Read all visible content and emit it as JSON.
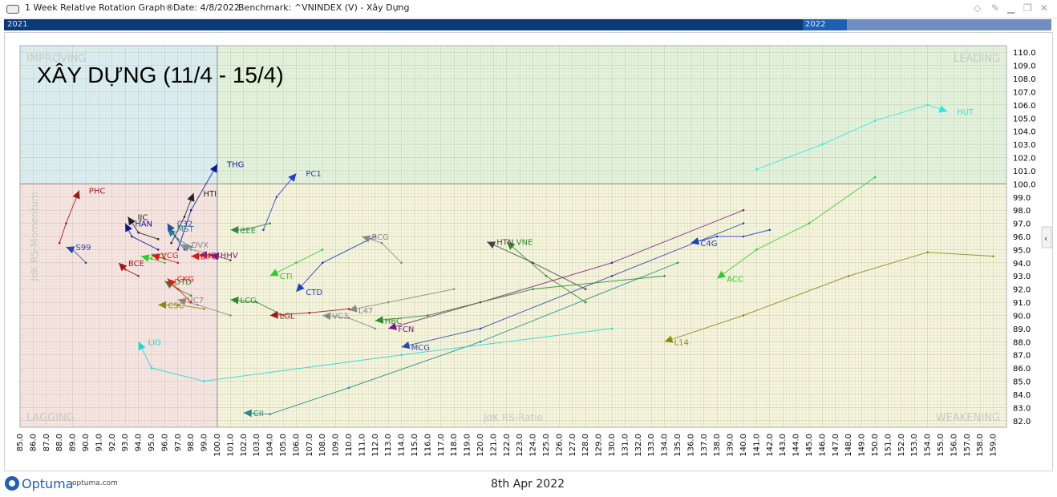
{
  "window": {
    "title": "1 Week Relative Rotation Graph®",
    "date": "Date: 4/8/2022",
    "benchmark": "Benchmark:  ^VNINDEX (V) - Xây Dựng"
  },
  "timeline": {
    "left_year": "2021",
    "right_year": "2022"
  },
  "footer": {
    "brand": "Optuma",
    "site": "optuma.com",
    "date_label": "8th Apr 2022"
  },
  "chart_data": {
    "type": "scatter",
    "title": "XÂY DỰNG (11/4 - 15/4)",
    "xlabel": "JdK RS-Ratio",
    "ylabel": "JdK RS-Momentum",
    "xlim": [
      85,
      160
    ],
    "ylim": [
      81.5,
      110.5
    ],
    "center": [
      100,
      100
    ],
    "xticks": [
      "85.0",
      "86.0",
      "87.0",
      "88.0",
      "89.0",
      "90.0",
      "91.0",
      "92.0",
      "93.0",
      "94.0",
      "95.0",
      "96.0",
      "97.0",
      "98.0",
      "99.0",
      "100.0",
      "101.0",
      "102.0",
      "103.0",
      "104.0",
      "105.0",
      "106.0",
      "107.0",
      "108.0",
      "109.0",
      "110.0",
      "111.0",
      "112.0",
      "113.0",
      "114.0",
      "115.0",
      "116.0",
      "117.0",
      "118.0",
      "119.0",
      "120.0",
      "121.0",
      "122.0",
      "123.0",
      "124.0",
      "125.0",
      "126.0",
      "127.0",
      "128.0",
      "129.0",
      "130.0",
      "131.0",
      "132.0",
      "133.0",
      "134.0",
      "135.0",
      "136.0",
      "137.0",
      "138.0",
      "139.0",
      "140.0",
      "141.0",
      "142.0",
      "143.0",
      "144.0",
      "145.0",
      "146.0",
      "147.0",
      "148.0",
      "149.0",
      "150.0",
      "151.0",
      "152.0",
      "153.0",
      "154.0",
      "155.0",
      "156.0",
      "157.0",
      "158.0",
      "159.0"
    ],
    "yticks": [
      "82.0",
      "83.0",
      "84.0",
      "85.0",
      "86.0",
      "87.0",
      "88.0",
      "89.0",
      "90.0",
      "91.0",
      "92.0",
      "93.0",
      "94.0",
      "95.0",
      "96.0",
      "97.0",
      "98.0",
      "99.0",
      "100.0",
      "101.0",
      "102.0",
      "103.0",
      "104.0",
      "105.0",
      "106.0",
      "107.0",
      "108.0",
      "109.0",
      "110.0"
    ],
    "quadrants": [
      {
        "label": "IMPROVING",
        "color": "#dbeef7"
      },
      {
        "label": "LEADING",
        "color": "#e3f3dd"
      },
      {
        "label": "LAGGING",
        "color": "#fbe3e4"
      },
      {
        "label": "WEAKENING",
        "color": "#f8f5dc"
      }
    ],
    "series": [
      {
        "name": "HUT",
        "color": "#2ee6e6",
        "points": [
          [
            141,
            101.1
          ],
          [
            146,
            103.0
          ],
          [
            150,
            104.8
          ],
          [
            154,
            106.0
          ],
          [
            155.5,
            105.5
          ]
        ]
      },
      {
        "name": "ACC",
        "color": "#2ecc2e",
        "points": [
          [
            150,
            100.5
          ],
          [
            145,
            97.0
          ],
          [
            141,
            95.0
          ],
          [
            138,
            92.8
          ]
        ]
      },
      {
        "name": "C4G",
        "color": "#1a3ccc",
        "points": [
          [
            142,
            96.5
          ],
          [
            140,
            96.0
          ],
          [
            138,
            96.0
          ],
          [
            136,
            95.5
          ]
        ]
      },
      {
        "name": "L14",
        "color": "#8a8a10",
        "points": [
          [
            159,
            94.5
          ],
          [
            154,
            94.8
          ],
          [
            148,
            93.0
          ],
          [
            140,
            90.0
          ],
          [
            134,
            88.0
          ]
        ]
      },
      {
        "name": "VNE",
        "color": "#2a8a2a",
        "points": [
          [
            128,
            91.0
          ],
          [
            125,
            93.0
          ],
          [
            122,
            95.6
          ]
        ]
      },
      {
        "name": "HTN",
        "color": "#444444",
        "points": [
          [
            128,
            92.0
          ],
          [
            124,
            94.0
          ],
          [
            120.5,
            95.6
          ]
        ]
      },
      {
        "name": "PHC",
        "color": "#a01818",
        "points": [
          [
            88,
            95.5
          ],
          [
            88.5,
            97.0
          ],
          [
            89.5,
            99.5
          ]
        ]
      },
      {
        "name": "THG",
        "color": "#0b1a99",
        "points": [
          [
            97,
            95.0
          ],
          [
            98,
            98.0
          ],
          [
            100,
            101.5
          ]
        ]
      },
      {
        "name": "HTI",
        "color": "#222222",
        "points": [
          [
            96.5,
            95.5
          ],
          [
            97.5,
            97.5
          ],
          [
            98.2,
            99.3
          ]
        ]
      },
      {
        "name": "PC1",
        "color": "#2a3ccc",
        "points": [
          [
            103.5,
            96.5
          ],
          [
            104.5,
            99.0
          ],
          [
            106,
            100.8
          ]
        ]
      },
      {
        "name": "HAN",
        "color": "#0b1a99",
        "points": [
          [
            95.5,
            95.0
          ],
          [
            93.5,
            96.0
          ],
          [
            93,
            97.0
          ]
        ]
      },
      {
        "name": "IJC",
        "color": "#222222",
        "points": [
          [
            95.5,
            95.8
          ],
          [
            94,
            96.3
          ],
          [
            93.2,
            97.5
          ]
        ]
      },
      {
        "name": "CII",
        "color": "#1f8a8a",
        "points": [
          [
            135,
            94.0
          ],
          [
            120,
            88.0
          ],
          [
            110,
            84.5
          ],
          [
            104,
            82.5
          ],
          [
            102,
            82.6
          ]
        ]
      },
      {
        "name": "LIG",
        "color": "#1ed8d8",
        "points": [
          [
            130,
            89.0
          ],
          [
            114,
            87.0
          ],
          [
            99,
            85.0
          ],
          [
            95,
            86.0
          ],
          [
            94,
            88.0
          ]
        ]
      },
      {
        "name": "CTD",
        "color": "#1a3ccc",
        "points": [
          [
            112,
            96.0
          ],
          [
            108,
            94.0
          ],
          [
            106,
            91.8
          ]
        ]
      },
      {
        "name": "FCN",
        "color": "#7a1a7a",
        "points": [
          [
            140,
            98.0
          ],
          [
            130,
            94.0
          ],
          [
            120,
            91.0
          ],
          [
            113,
            89.0
          ]
        ]
      },
      {
        "name": "MCG",
        "color": "#2a4aa8",
        "points": [
          [
            140,
            97.0
          ],
          [
            130,
            93.0
          ],
          [
            120,
            89.0
          ],
          [
            114,
            87.6
          ]
        ]
      },
      {
        "name": "HBC",
        "color": "#2a8a2a",
        "points": [
          [
            134,
            93.0
          ],
          [
            124,
            92.0
          ],
          [
            116,
            90.0
          ],
          [
            112,
            89.6
          ]
        ]
      },
      {
        "name": "LCG",
        "color": "#2a8a2a",
        "points": [
          [
            105,
            90.0
          ],
          [
            103,
            91.0
          ],
          [
            101,
            91.2
          ]
        ]
      },
      {
        "name": "CTI",
        "color": "#2ecc2e",
        "points": [
          [
            108,
            95.0
          ],
          [
            106,
            94.0
          ],
          [
            104,
            93.0
          ]
        ]
      },
      {
        "name": "CEE",
        "color": "#2a8a4a",
        "points": [
          [
            104,
            97.0
          ],
          [
            102,
            96.5
          ],
          [
            101,
            96.5
          ]
        ]
      },
      {
        "name": "BCG",
        "color": "#888888",
        "points": [
          [
            114,
            94.0
          ],
          [
            112.5,
            95.5
          ],
          [
            111,
            96.0
          ]
        ]
      },
      {
        "name": "L47",
        "color": "#888888",
        "points": [
          [
            118,
            92.0
          ],
          [
            113,
            91.0
          ],
          [
            110,
            90.4
          ]
        ]
      },
      {
        "name": "LGL",
        "color": "#a01818",
        "points": [
          [
            110,
            90.5
          ],
          [
            107,
            90.2
          ],
          [
            104,
            90.0
          ]
        ]
      },
      {
        "name": "VC3",
        "color": "#888888",
        "points": [
          [
            112,
            89.0
          ],
          [
            110,
            89.8
          ],
          [
            108,
            90.0
          ]
        ]
      },
      {
        "name": "VC7",
        "color": "#888888",
        "points": [
          [
            101,
            90.0
          ],
          [
            98.5,
            90.8
          ],
          [
            97,
            91.2
          ]
        ]
      },
      {
        "name": "CSC",
        "color": "#8a8a10",
        "points": [
          [
            99,
            90.5
          ],
          [
            97,
            90.8
          ],
          [
            95.5,
            90.8
          ]
        ]
      },
      {
        "name": "DTD",
        "color": "#2a8a2a",
        "points": [
          [
            98,
            91.5
          ],
          [
            97,
            92.0
          ],
          [
            96,
            92.6
          ]
        ]
      },
      {
        "name": "CKG",
        "color": "#e01818",
        "points": [
          [
            98,
            91.0
          ],
          [
            97,
            92.0
          ],
          [
            96.2,
            92.8
          ]
        ]
      },
      {
        "name": "BCE",
        "color": "#a01818",
        "points": [
          [
            94,
            93.0
          ],
          [
            93,
            93.5
          ],
          [
            92.5,
            94.0
          ]
        ]
      },
      {
        "name": "FRT",
        "color": "#2ecc2e",
        "points": [
          [
            96,
            94.0
          ],
          [
            95,
            94.3
          ],
          [
            94.2,
            94.5
          ]
        ]
      },
      {
        "name": "S99",
        "color": "#2a4aa8",
        "points": [
          [
            90,
            94.0
          ],
          [
            89,
            95.0
          ],
          [
            88.5,
            95.2
          ]
        ]
      },
      {
        "name": "VCG",
        "color": "#e01818",
        "points": [
          [
            97,
            94.0
          ],
          [
            96,
            94.3
          ],
          [
            95,
            94.6
          ]
        ]
      },
      {
        "name": "IDJ",
        "color": "#7a1a7a",
        "points": [
          [
            99.5,
            94.6
          ],
          [
            99,
            94.6
          ],
          [
            98.6,
            94.6
          ]
        ]
      },
      {
        "name": "DPG",
        "color": "#e01818",
        "points": [
          [
            99,
            94.5
          ],
          [
            98.5,
            94.5
          ],
          [
            98,
            94.5
          ]
        ]
      },
      {
        "name": "HHV",
        "color": "#7a1a7a",
        "points": [
          [
            101,
            94.2
          ],
          [
            100,
            94.5
          ],
          [
            99.5,
            94.6
          ]
        ]
      },
      {
        "name": "MST",
        "color": "#1f8a8a",
        "points": [
          [
            98,
            95.2
          ],
          [
            97,
            95.8
          ],
          [
            96.2,
            96.6
          ]
        ]
      },
      {
        "name": "C32",
        "color": "#2a4aa8",
        "points": [
          [
            97.5,
            95.0
          ],
          [
            96.8,
            96.0
          ],
          [
            96.2,
            97.0
          ]
        ]
      },
      {
        "name": "DVX",
        "color": "#888888",
        "points": [
          [
            99,
            94.8
          ],
          [
            98,
            95.0
          ],
          [
            97.3,
            95.4
          ]
        ]
      }
    ]
  }
}
